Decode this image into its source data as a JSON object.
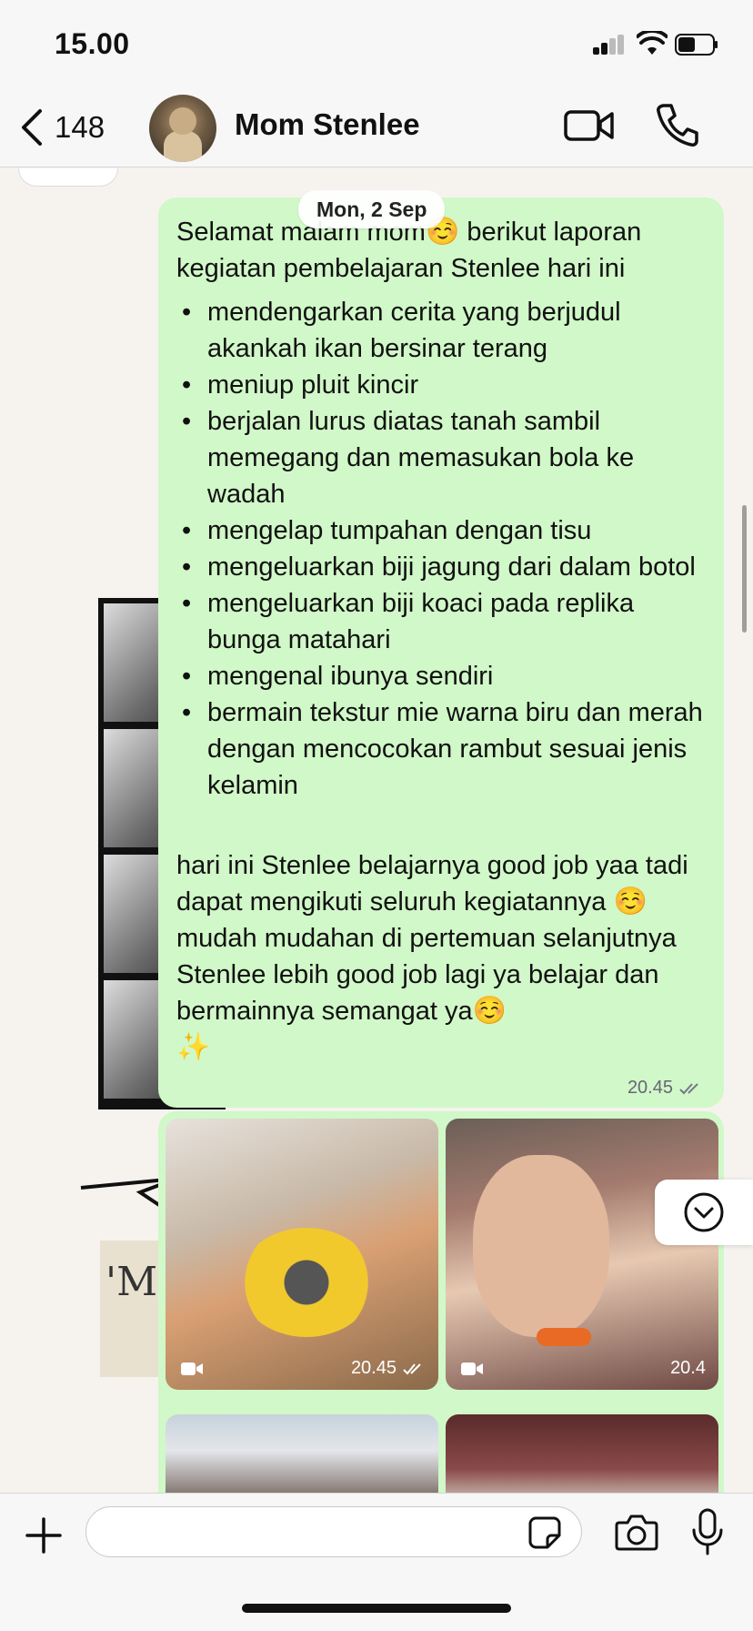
{
  "status": {
    "time": "15.00"
  },
  "header": {
    "back_count": "148",
    "contact_name": "Mom Stenlee"
  },
  "chat": {
    "date_chip": "Mon, 2 Sep",
    "message": {
      "intro_line1": "Selamat malam mom",
      "intro_emoji": "☺️",
      "intro_line2": " berikut laporan kegiatan pembelajaran Stenlee hari ini",
      "items": [
        "mendengarkan cerita yang berjudul akankah ikan bersinar terang",
        "meniup pluit kincir",
        "berjalan lurus diatas tanah sambil memegang dan memasukan bola ke wadah",
        "mengelap tumpahan dengan tisu",
        "mengeluarkan biji jagung dari dalam botol",
        "mengeluarkan biji koaci pada replika bunga matahari",
        "mengenal ibunya sendiri",
        "bermain tekstur mie warna biru dan merah dengan mencocokan rambut sesuai jenis kelamin"
      ],
      "outro_part1": "hari ini Stenlee belajarnya good job yaa tadi dapat mengikuti seluruh kegiatannya ",
      "outro_emoji1": "☺️",
      "outro_part2": "mudah mudahan di pertemuan selanjutnya Stenlee lebih good job lagi ya belajar dan bermainnya semangat ya",
      "outro_emoji2": "☺️",
      "outro_emoji3": "✨",
      "time": "20.45"
    },
    "media": [
      {
        "type": "video",
        "time": "20.45",
        "show_ticks": true
      },
      {
        "type": "video",
        "time": "20.4",
        "show_ticks": false
      }
    ],
    "wallpaper_text": "'Mi"
  },
  "input": {
    "placeholder": ""
  },
  "colors": {
    "bubble": "#d1f8c8",
    "header": "#f7f7f7",
    "read_ticks": "#667788"
  },
  "icons": [
    "back-chevron-icon",
    "video-call-icon",
    "phone-icon",
    "plus-icon",
    "sticker-icon",
    "camera-icon",
    "microphone-icon",
    "video-icon",
    "read-ticks-icon",
    "chevron-down-icon"
  ]
}
